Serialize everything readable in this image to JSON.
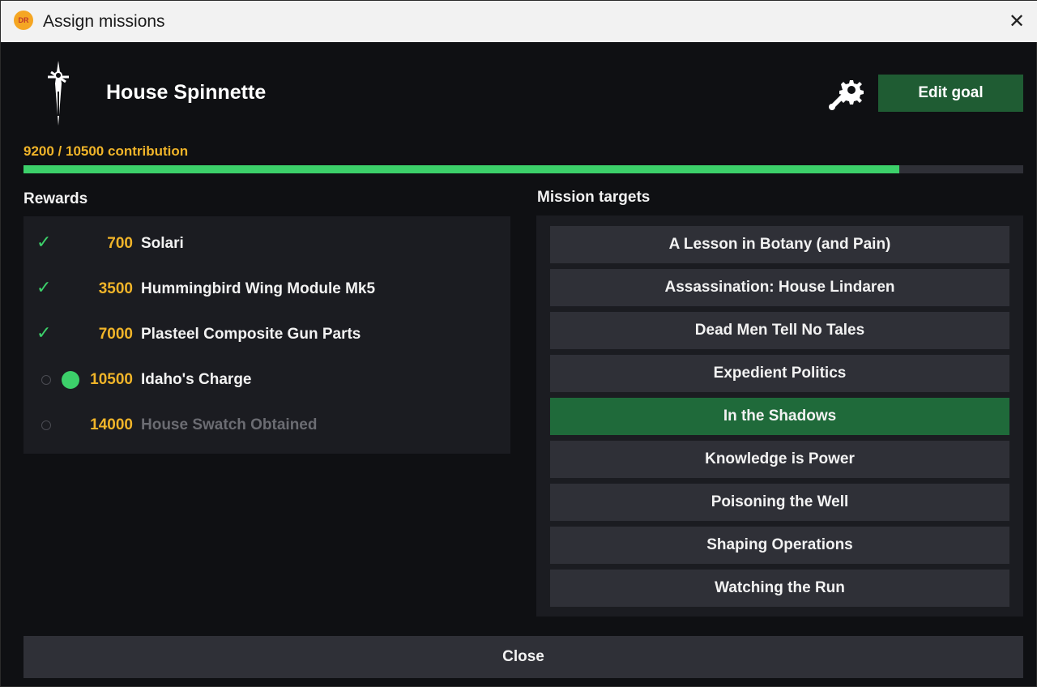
{
  "window": {
    "title": "Assign missions",
    "close_glyph": "✕",
    "app_icon": "DR"
  },
  "house": {
    "name": "House Spinnette",
    "emblem_icon": "house-spinnette-emblem"
  },
  "header": {
    "settings_icon": "gear-wrench-icon",
    "edit_goal_label": "Edit goal"
  },
  "contribution": {
    "text": "9200 / 10500 contribution",
    "current": 9200,
    "goal": 10500,
    "progress_fraction": 0.876
  },
  "rewards": {
    "label": "Rewards",
    "items": [
      {
        "status": "claimed",
        "check": "✓",
        "value": "700",
        "name": "Solari"
      },
      {
        "status": "claimed",
        "check": "✓",
        "value": "3500",
        "name": "Hummingbird Wing Module Mk5"
      },
      {
        "status": "claimed",
        "check": "✓",
        "value": "7000",
        "name": "Plasteel Composite Gun Parts"
      },
      {
        "status": "goal",
        "check": "",
        "value": "10500",
        "name": "Idaho's Charge"
      },
      {
        "status": "locked",
        "check": "",
        "value": "14000",
        "name": "House Swatch Obtained"
      }
    ]
  },
  "targets": {
    "label": "Mission targets",
    "items": [
      {
        "label": "A Lesson in Botany (and Pain)",
        "selected": false
      },
      {
        "label": "Assassination: House Lindaren",
        "selected": false
      },
      {
        "label": "Dead Men Tell No Tales",
        "selected": false
      },
      {
        "label": "Expedient Politics",
        "selected": false
      },
      {
        "label": "In the Shadows",
        "selected": true
      },
      {
        "label": "Knowledge is Power",
        "selected": false
      },
      {
        "label": "Poisoning the Well",
        "selected": false
      },
      {
        "label": "Shaping Operations",
        "selected": false
      },
      {
        "label": "Watching the Run",
        "selected": false
      }
    ]
  },
  "footer": {
    "close_label": "Close"
  },
  "colors": {
    "accent_green": "#3cd06a",
    "button_green": "#1f5c33",
    "gold": "#f0b429",
    "background": "#0f1013",
    "panel": "#1b1c21",
    "button": "#2f3037"
  }
}
